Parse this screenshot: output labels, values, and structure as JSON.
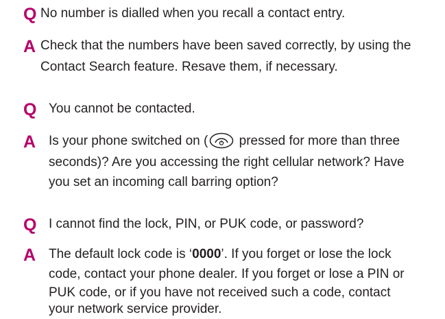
{
  "faq": [
    {
      "q_marker": "Q",
      "question": "No number is dialled when you recall a contact entry.",
      "a_marker": "A",
      "answer_lines": [
        "Check that the numbers have been saved correctly, by using the",
        "Contact Search feature. Resave them, if necessary."
      ]
    },
    {
      "q_marker": "Q",
      "question": "You cannot be contacted.",
      "a_marker": "A",
      "answer_line1_before": "Is your phone switched on (",
      "answer_line1_after": "pressed for more than three",
      "answer_lines_rest": [
        "seconds)? Are you accessing the right cellular network? Have",
        "you set an incoming call barring option?"
      ],
      "icon": "end-call-power-key-icon"
    },
    {
      "q_marker": "Q",
      "question": "I cannot find the lock, PIN, or PUK code, or password?",
      "a_marker": "A",
      "answer_line1_before": "The default lock code is ‘",
      "answer_line1_bold": "0000",
      "answer_line1_after": "’. If you forget or lose the lock",
      "answer_lines_rest": [
        "code, contact your phone dealer. If you forget or lose a PIN or",
        "PUK code, or if you have not received such a code, contact",
        "your network service provider."
      ]
    }
  ],
  "colors": {
    "marker": "#b5006a",
    "text": "#231f20"
  }
}
